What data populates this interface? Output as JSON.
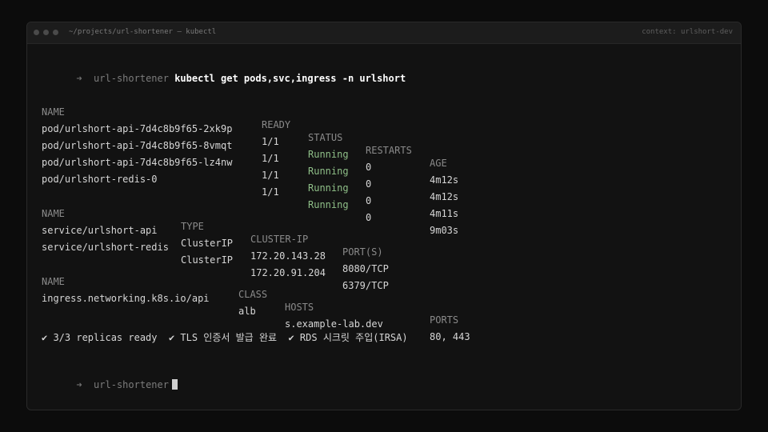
{
  "window": {
    "title": "~/projects/url-shortener — kubectl",
    "context": "context: urlshort-dev"
  },
  "prompt": {
    "arrow": "➜",
    "dir": "url-shortener"
  },
  "command": "kubectl get pods,svc,ingress -n urlshort",
  "pods": {
    "headers": [
      "NAME",
      "READY",
      "STATUS",
      "RESTARTS",
      "AGE"
    ],
    "rows": [
      [
        "pod/urlshort-api-7d4c8b9f65-2xk9p",
        "1/1",
        "Running",
        "0",
        "4m12s"
      ],
      [
        "pod/urlshort-api-7d4c8b9f65-8vmqt",
        "1/1",
        "Running",
        "0",
        "4m12s"
      ],
      [
        "pod/urlshort-api-7d4c8b9f65-lz4nw",
        "1/1",
        "Running",
        "0",
        "4m11s"
      ],
      [
        "pod/urlshort-redis-0",
        "1/1",
        "Running",
        "0",
        "9m03s"
      ]
    ]
  },
  "services": {
    "headers": [
      "NAME",
      "TYPE",
      "CLUSTER-IP",
      "PORT(S)"
    ],
    "rows": [
      [
        "service/urlshort-api",
        "ClusterIP",
        "172.20.143.28",
        "8080/TCP"
      ],
      [
        "service/urlshort-redis",
        "ClusterIP",
        "172.20.91.204",
        "6379/TCP"
      ]
    ]
  },
  "ingress": {
    "headers": [
      "NAME",
      "CLASS",
      "HOSTS",
      "PORTS"
    ],
    "rows": [
      [
        "ingress.networking.k8s.io/api",
        "alb",
        "s.example-lab.dev",
        "80, 443"
      ]
    ]
  },
  "summary": "✔ 3/3 replicas ready  ✔ TLS 인증서 발급 완료  ✔ RDS 시크릿 주입(IRSA)",
  "colors": {
    "running": "#8fbf88",
    "background": "#121212"
  }
}
